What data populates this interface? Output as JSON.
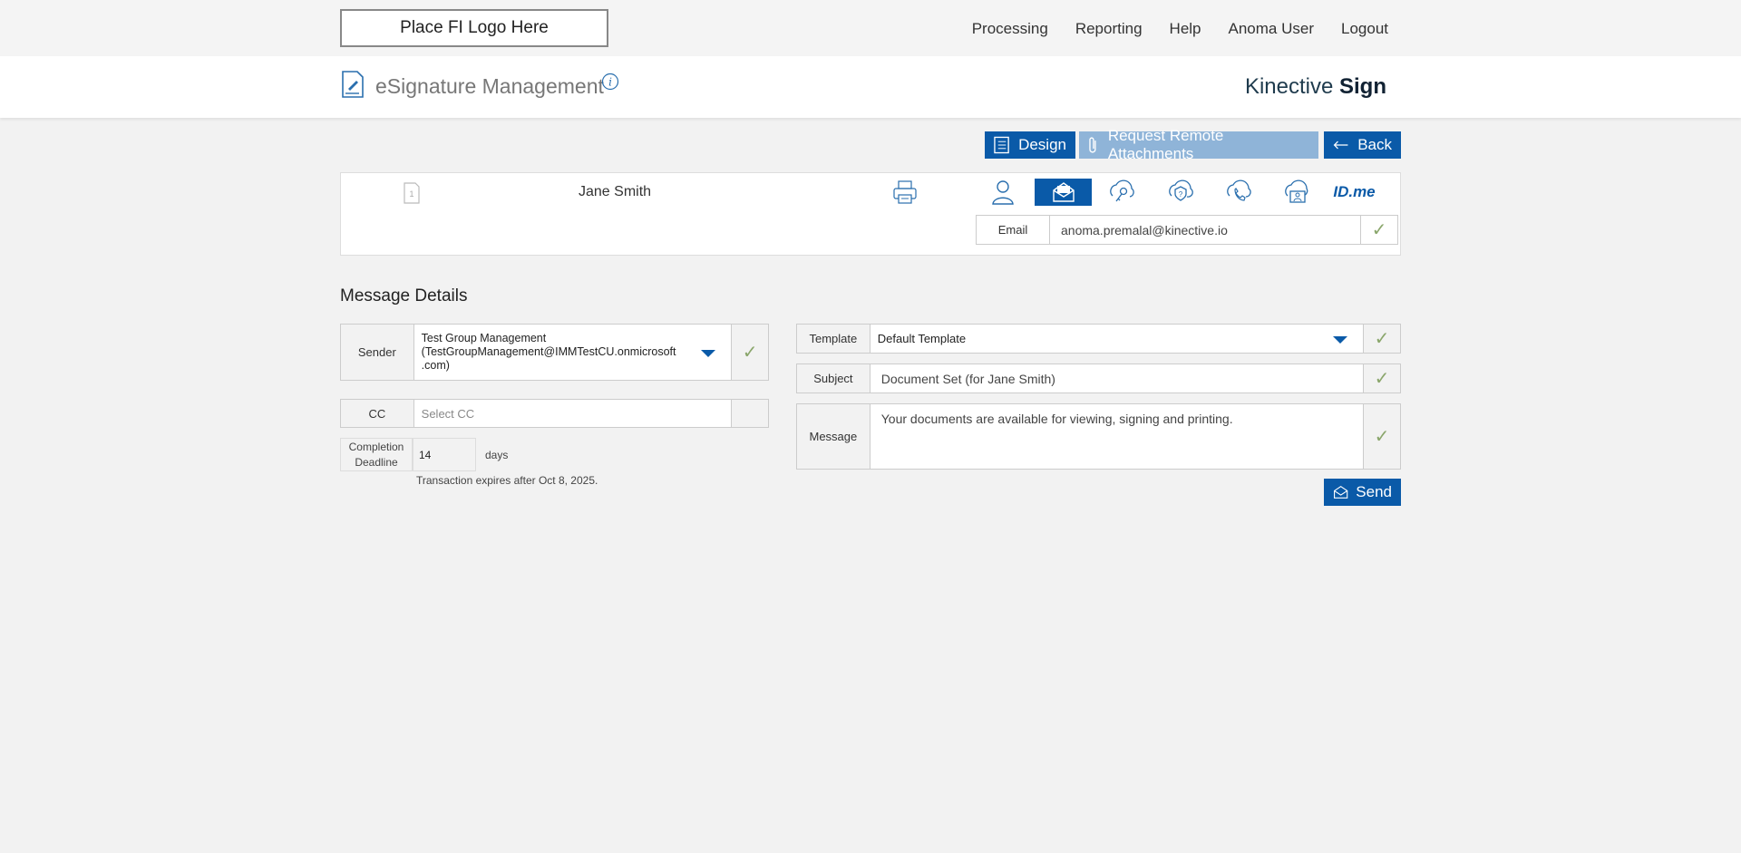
{
  "header": {
    "logo_placeholder": "Place FI Logo Here",
    "nav": [
      "Processing",
      "Reporting",
      "Help",
      "Anoma User",
      "Logout"
    ],
    "app_title": "eSignature Management",
    "brand_regular": "Kinective ",
    "brand_bold": "Sign"
  },
  "toolbar": {
    "design_label": "Design",
    "attachments_label": "Request Remote Attachments",
    "back_label": "Back"
  },
  "signer": {
    "doc_count": "1",
    "name": "Jane Smith",
    "auth_methods": [
      "person-icon",
      "email-icon",
      "key-icon",
      "kba-icon",
      "phone-icon",
      "id-card-icon",
      "idme-icon"
    ],
    "active_method": "email-icon",
    "idme_text": "ID.me",
    "email_label": "Email",
    "email_value": "anoma.premalal@kinective.io"
  },
  "message": {
    "section_title": "Message Details",
    "sender_label": "Sender",
    "sender_value_line1": "Test Group Management",
    "sender_value_line2": "(TestGroupManagement@IMMTestCU.onmicrosoft",
    "sender_value_line3": ".com)",
    "cc_label": "CC",
    "cc_placeholder": "Select CC",
    "deadline_label": "Completion Deadline",
    "deadline_value": "14",
    "deadline_unit": "days",
    "expires_text": "Transaction expires after Oct 8, 2025.",
    "template_label": "Template",
    "template_value": "Default Template",
    "subject_label": "Subject",
    "subject_value": "Document Set (for Jane Smith)",
    "message_label": "Message",
    "message_value": "Your documents are available for viewing, signing and printing.",
    "send_label": "Send"
  },
  "colors": {
    "primary": "#0a5aa8",
    "disabled": "#8fb4d8",
    "check": "#8aa66b"
  }
}
